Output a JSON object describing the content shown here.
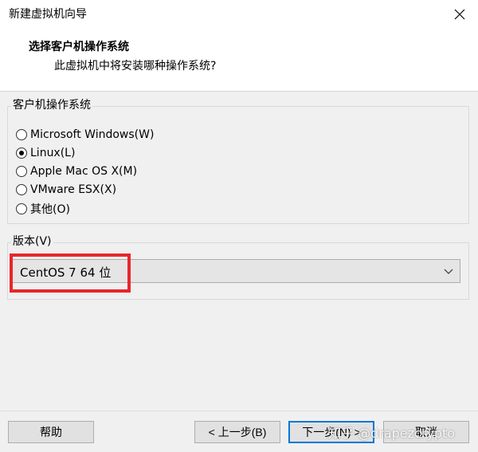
{
  "window": {
    "title": "新建虚拟机向导"
  },
  "header": {
    "title": "选择客户机操作系统",
    "subtitle": "此虚拟机中将安装哪种操作系统?"
  },
  "os_group": {
    "label": "客户机操作系统",
    "options": [
      {
        "label": "Microsoft Windows(W)",
        "selected": false
      },
      {
        "label": "Linux(L)",
        "selected": true
      },
      {
        "label": "Apple Mac OS X(M)",
        "selected": false
      },
      {
        "label": "VMware ESX(X)",
        "selected": false
      },
      {
        "label": "其他(O)",
        "selected": false
      }
    ]
  },
  "version_group": {
    "label": "版本(V)",
    "selected_value": "CentOS 7 64 位"
  },
  "buttons": {
    "help": "帮助",
    "back": "< 上一步(B)",
    "next": "下一步(N) >",
    "cancel": "取消"
  },
  "watermark": "知乎 @drapezcrypto",
  "colors": {
    "highlight": "#e8262b",
    "focus_border": "#0078d7"
  }
}
